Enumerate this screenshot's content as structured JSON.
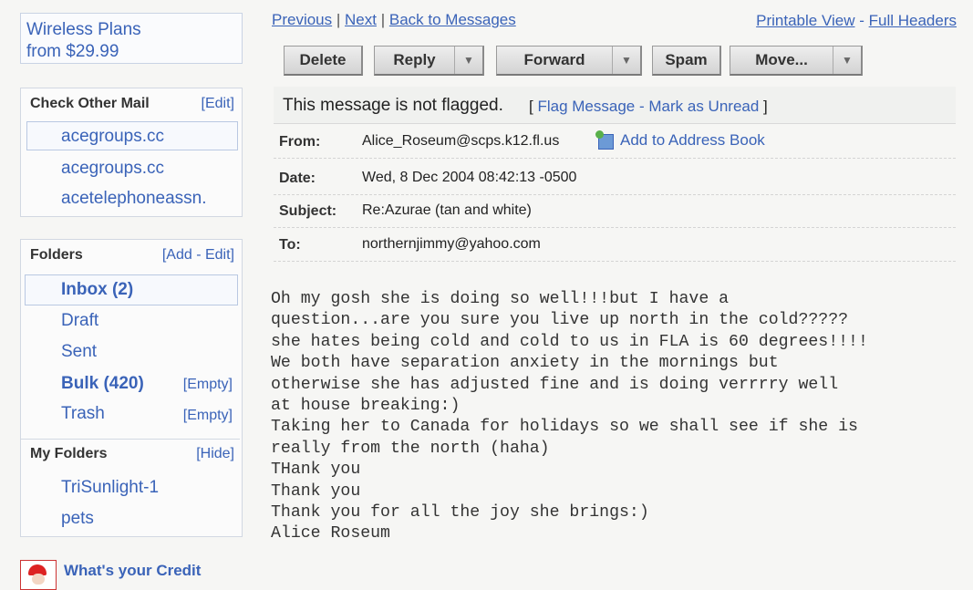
{
  "ad_top": {
    "line1": "Wireless Plans",
    "line2": "from $29.99"
  },
  "check_mail": {
    "title": "Check Other Mail",
    "edit": "[Edit]",
    "accounts": [
      "acegroups.cc",
      "acegroups.cc",
      "acetelephoneassn."
    ]
  },
  "folders": {
    "title": "Folders",
    "add": "Add",
    "edit": "Edit",
    "items": [
      {
        "label": "Inbox (2)",
        "action": ""
      },
      {
        "label": "Draft",
        "action": ""
      },
      {
        "label": "Sent",
        "action": ""
      },
      {
        "label": "Bulk (420)",
        "action": "[Empty]"
      },
      {
        "label": "Trash",
        "action": "[Empty]"
      }
    ],
    "my_folders_title": "My Folders",
    "hide": "[Hide]",
    "my_folders": [
      "TriSunlight-1",
      "pets"
    ]
  },
  "credit_ad": {
    "text": "What's your Credit"
  },
  "nav": {
    "previous": "Previous",
    "next": "Next",
    "back": "Back to Messages",
    "printable": "Printable View",
    "full_headers": "Full Headers"
  },
  "toolbar": {
    "delete": "Delete",
    "reply": "Reply",
    "forward": "Forward",
    "spam": "Spam",
    "move": "Move..."
  },
  "flag": {
    "status": "This message is not flagged.",
    "flag_link": "Flag Message",
    "unread_link": "Mark as Unread"
  },
  "header": {
    "from_label": "From:",
    "from": "Alice_Roseum@scps.k12.fl.us",
    "add_book": "Add to Address Book",
    "date_label": "Date:",
    "date": "Wed, 8 Dec 2004 08:42:13 -0500",
    "subject_label": "Subject:",
    "subject": "Re:Azurae (tan and white)",
    "to_label": "To:",
    "to": "northernjimmy@yahoo.com"
  },
  "body": "Oh my gosh she is doing so well!!!but I have a\nquestion...are you sure you live up north in the cold?????\nshe hates being cold and cold to us in FLA is 60 degrees!!!!\nWe both have separation anxiety in the mornings but\notherwise she has adjusted fine and is doing verrrry well\nat house breaking:)\nTaking her to Canada for holidays so we shall see if she is\nreally from the north (haha)\nTHank you\nThank you\nThank you for all the joy she brings:)\nAlice Roseum"
}
